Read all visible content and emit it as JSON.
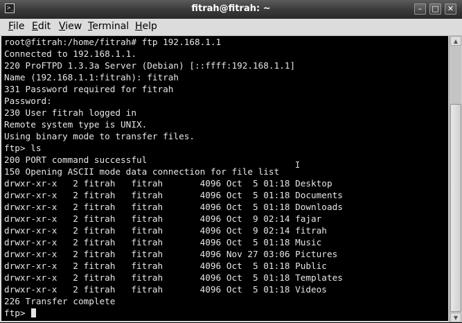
{
  "window": {
    "title": "fitrah@fitrah: ~",
    "buttons": {
      "minimize": "–",
      "maximize": "□",
      "close": "✕"
    }
  },
  "menu": [
    {
      "mnemonic": "F",
      "rest": "ile"
    },
    {
      "mnemonic": "E",
      "rest": "dit"
    },
    {
      "mnemonic": "V",
      "rest": "iew"
    },
    {
      "mnemonic": "T",
      "rest": "erminal"
    },
    {
      "mnemonic": "H",
      "rest": "elp"
    }
  ],
  "terminal": {
    "lines": [
      "root@fitrah:/home/fitrah# ftp 192.168.1.1",
      "Connected to 192.168.1.1.",
      "220 ProFTPD 1.3.3a Server (Debian) [::ffff:192.168.1.1]",
      "Name (192.168.1.1:fitrah): fitrah",
      "331 Password required for fitrah",
      "Password:",
      "230 User fitrah logged in",
      "Remote system type is UNIX.",
      "Using binary mode to transfer files.",
      "ftp> ls",
      "200 PORT command successful",
      "150 Opening ASCII mode data connection for file list",
      "drwxr-xr-x   2 fitrah   fitrah       4096 Oct  5 01:18 Desktop",
      "drwxr-xr-x   2 fitrah   fitrah       4096 Oct  5 01:18 Documents",
      "drwxr-xr-x   2 fitrah   fitrah       4096 Oct  5 01:18 Downloads",
      "drwxr-xr-x   2 fitrah   fitrah       4096 Oct  9 02:14 fajar",
      "drwxr-xr-x   2 fitrah   fitrah       4096 Oct  9 02:14 fitrah",
      "drwxr-xr-x   2 fitrah   fitrah       4096 Oct  5 01:18 Music",
      "drwxr-xr-x   2 fitrah   fitrah       4096 Nov 27 03:06 Pictures",
      "drwxr-xr-x   2 fitrah   fitrah       4096 Oct  5 01:18 Public",
      "drwxr-xr-x   2 fitrah   fitrah       4096 Oct  5 01:18 Templates",
      "drwxr-xr-x   2 fitrah   fitrah       4096 Oct  5 01:18 Videos",
      "226 Transfer complete",
      "ftp> "
    ],
    "scroll_position_fraction": 1.0,
    "scroll_visible_fraction": 0.78
  }
}
